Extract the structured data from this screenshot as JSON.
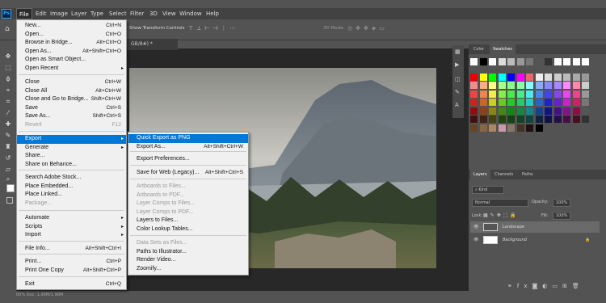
{
  "menubar": {
    "logo": "Ps",
    "items": [
      "File",
      "Edit",
      "Image",
      "Layer",
      "Type",
      "Select",
      "Filter",
      "3D",
      "View",
      "Window",
      "Help"
    ]
  },
  "options": {
    "transform_label": "Show Transform Controls",
    "mode_label": "3D Mode:"
  },
  "doc_tab": "GB/8#) *",
  "file_menu": {
    "items": [
      {
        "label": "New...",
        "shortcut": "Ctrl+N"
      },
      {
        "label": "Open...",
        "shortcut": "Ctrl+O"
      },
      {
        "label": "Browse in Bridge...",
        "shortcut": "Alt+Ctrl+O"
      },
      {
        "label": "Open As...",
        "shortcut": "Alt+Shift+Ctrl+O"
      },
      {
        "label": "Open as Smart Object...",
        "shortcut": ""
      },
      {
        "label": "Open Recent",
        "shortcut": ""
      },
      {
        "label": "Close",
        "shortcut": "Ctrl+W"
      },
      {
        "label": "Close All",
        "shortcut": "Alt+Ctrl+W"
      },
      {
        "label": "Close and Go to Bridge...",
        "shortcut": "Shift+Ctrl+W"
      },
      {
        "label": "Save",
        "shortcut": "Ctrl+S"
      },
      {
        "label": "Save As...",
        "shortcut": "Shift+Ctrl+S"
      },
      {
        "label": "Revert",
        "shortcut": "F12"
      },
      {
        "label": "Export",
        "shortcut": ""
      },
      {
        "label": "Generate",
        "shortcut": ""
      },
      {
        "label": "Share...",
        "shortcut": ""
      },
      {
        "label": "Share on Behance...",
        "shortcut": ""
      },
      {
        "label": "Search Adobe Stock...",
        "shortcut": ""
      },
      {
        "label": "Place Embedded...",
        "shortcut": ""
      },
      {
        "label": "Place Linked...",
        "shortcut": ""
      },
      {
        "label": "Package...",
        "shortcut": ""
      },
      {
        "label": "Automate",
        "shortcut": ""
      },
      {
        "label": "Scripts",
        "shortcut": ""
      },
      {
        "label": "Import",
        "shortcut": ""
      },
      {
        "label": "File Info...",
        "shortcut": "Alt+Shift+Ctrl+I"
      },
      {
        "label": "Print...",
        "shortcut": "Ctrl+P"
      },
      {
        "label": "Print One Copy",
        "shortcut": "Alt+Shift+Ctrl+P"
      },
      {
        "label": "Exit",
        "shortcut": "Ctrl+Q"
      }
    ]
  },
  "export_menu": {
    "items": [
      {
        "label": "Quick Export as PNG",
        "shortcut": ""
      },
      {
        "label": "Export As...",
        "shortcut": "Alt+Shift+Ctrl+W"
      },
      {
        "label": "Export Preferences...",
        "shortcut": ""
      },
      {
        "label": "Save for Web (Legacy)...",
        "shortcut": "Alt+Shift+Ctrl+S"
      },
      {
        "label": "Artboards to Files...",
        "shortcut": ""
      },
      {
        "label": "Artboards to PDF...",
        "shortcut": ""
      },
      {
        "label": "Layer Comps to Files...",
        "shortcut": ""
      },
      {
        "label": "Layer Comps to PDF...",
        "shortcut": ""
      },
      {
        "label": "Layers to Files...",
        "shortcut": ""
      },
      {
        "label": "Color Lookup Tables...",
        "shortcut": ""
      },
      {
        "label": "Data Sets as Files...",
        "shortcut": ""
      },
      {
        "label": "Paths to Illustrator...",
        "shortcut": ""
      },
      {
        "label": "Render Video...",
        "shortcut": ""
      },
      {
        "label": "Zoomify...",
        "shortcut": ""
      }
    ]
  },
  "panels": {
    "color_tab": "Color",
    "swatches_tab": "Swatches",
    "layers_tab": "Layers",
    "channels_tab": "Channels",
    "paths_tab": "Paths",
    "kind_label": "Kind",
    "blend_mode": "Normal",
    "opacity_label": "Opacity:",
    "opacity_value": "100%",
    "lock_label": "Lock:",
    "fill_label": "Fill:",
    "fill_value": "100%",
    "layers": [
      "Landscape",
      "Background"
    ]
  },
  "status": "00% Doc: 1.98M/1.98M"
}
